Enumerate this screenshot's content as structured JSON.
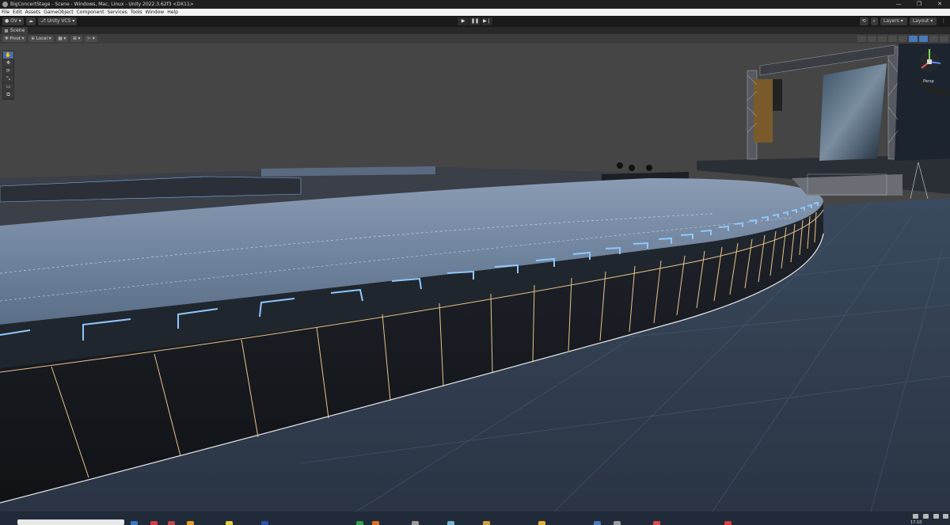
{
  "window": {
    "title": "BigConcertStage - Scene - Windows, Mac, Linux - Unity 2022.3.62f3 <DX11>",
    "controls": [
      "—",
      "❐",
      "✕"
    ]
  },
  "menu": [
    "File",
    "Edit",
    "Assets",
    "GameObject",
    "Component",
    "Services",
    "Tools",
    "Window",
    "Help"
  ],
  "toolbar": {
    "account": "OV",
    "vcs": "Unity VCS",
    "play": "▶",
    "pause": "❚❚",
    "step": "▶❘",
    "layers": "Layers",
    "layout": "Layout"
  },
  "scene_tab": {
    "label": "Scene"
  },
  "scene_toolbar": {
    "pivot": "Pivot",
    "space": "Local"
  },
  "gizmo": {
    "view_label": "Persp"
  },
  "taskbar": {
    "time": "17:10"
  },
  "colors": {
    "accent": "#4a78b8",
    "led": "#8ec8ff",
    "seam": "#e8c48a"
  }
}
